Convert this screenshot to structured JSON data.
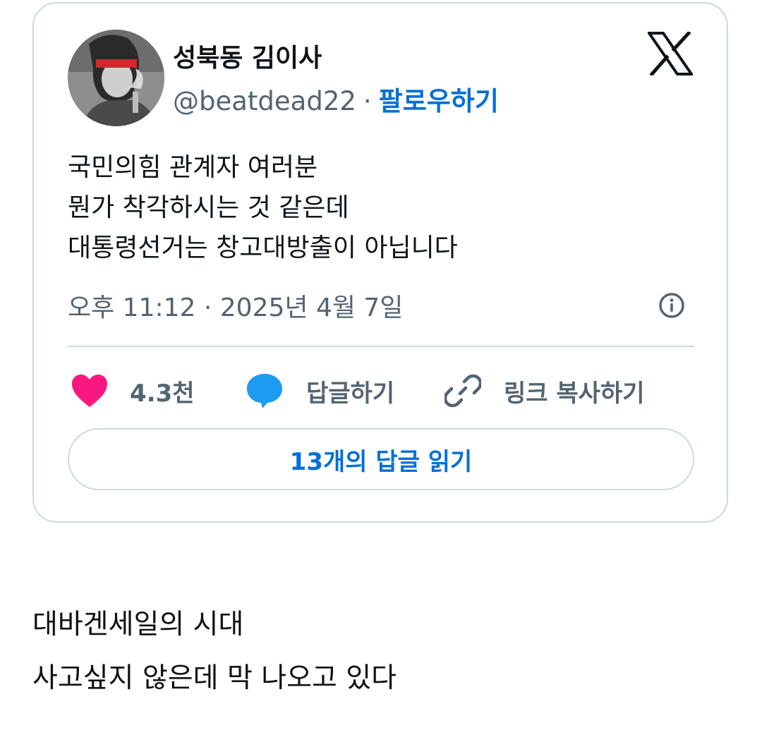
{
  "tweet": {
    "display_name": "성북동 김이사",
    "handle": "@beatdead22",
    "separator": "·",
    "follow_label": "팔로우하기",
    "text_lines": [
      "국민의힘 관계자 여러분",
      "뭔가 착각하시는 것 같은데",
      "대통령선거는 창고대방출이 아닙니다"
    ],
    "time": "오후 11:12 · 2025년 4월 7일",
    "actions": {
      "like_count": "4.3천",
      "reply_label": "답글하기",
      "copy_link_label": "링크 복사하기"
    },
    "read_replies_label": "13개의 답글 읽기"
  },
  "post_body": {
    "lines": [
      "대바겐세일의 시대",
      "사고싶지 않은데 막 나오고 있다"
    ]
  },
  "icons": {
    "brand": "x-logo-icon",
    "like": "heart-icon",
    "reply": "speech-bubble-icon",
    "copy": "link-icon",
    "info": "info-icon"
  },
  "colors": {
    "like": "#f91880",
    "reply": "#1d9bf0",
    "link": "#006fd6",
    "muted": "#536471",
    "border": "#cfd9de"
  }
}
